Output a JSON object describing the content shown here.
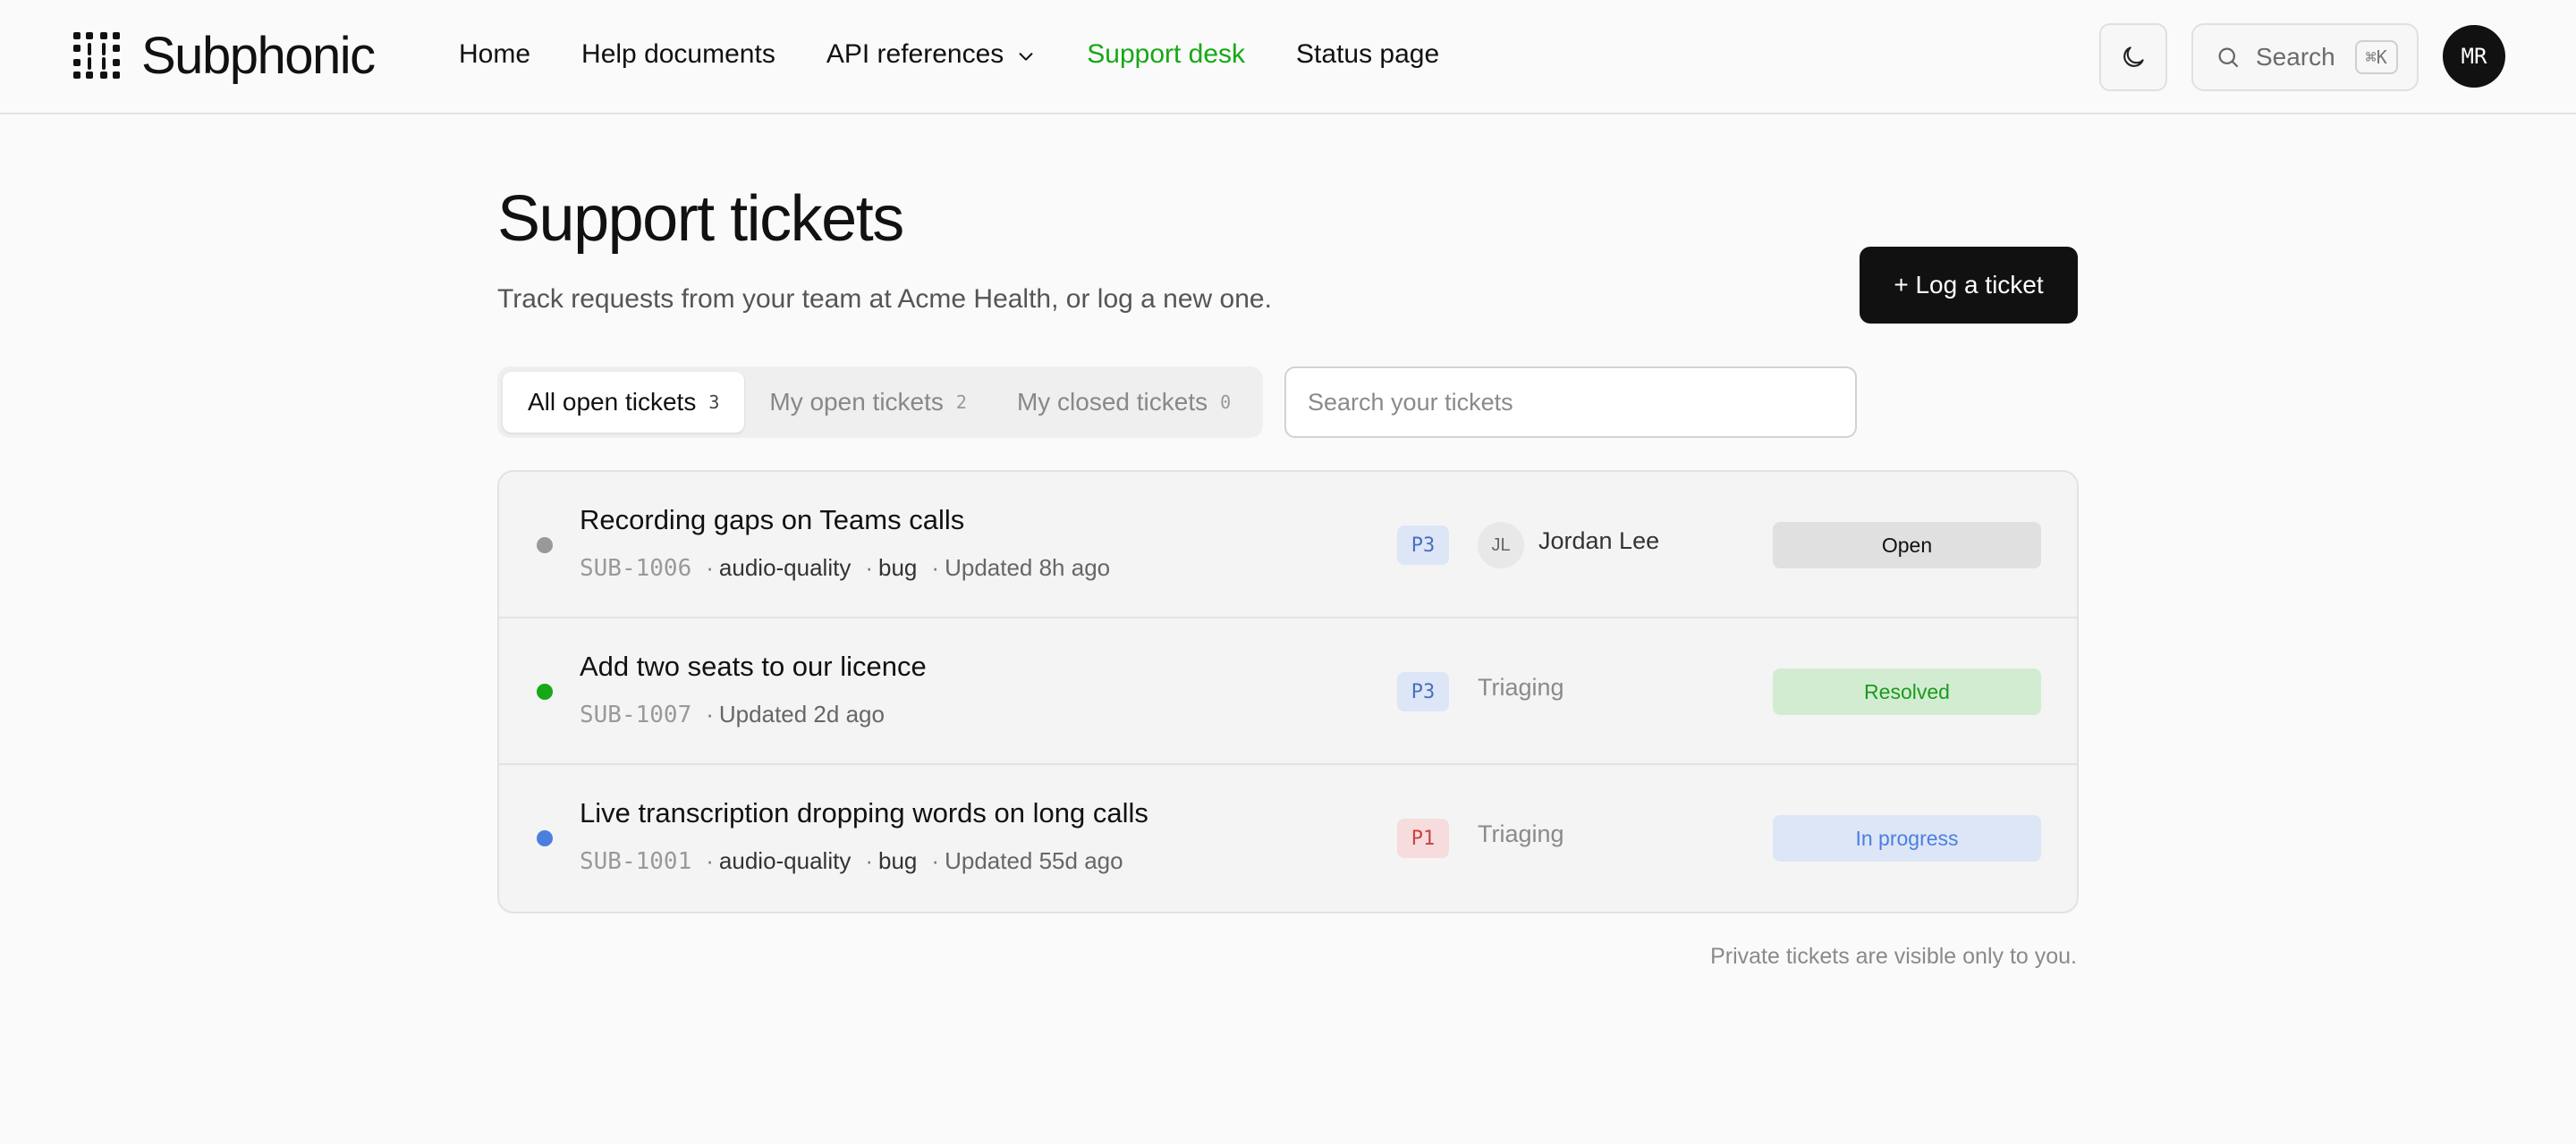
{
  "header": {
    "brand": "Subphonic",
    "nav": [
      {
        "label": "Home"
      },
      {
        "label": "Help documents"
      },
      {
        "label": "API references"
      },
      {
        "label": "Support desk"
      },
      {
        "label": "Status page"
      }
    ],
    "search_label": "Search",
    "search_shortcut": "⌘K",
    "user_initials": "MR"
  },
  "page": {
    "title": "Support tickets",
    "subtitle": "Track requests from your team at Acme Health, or log a new one.",
    "log_ticket_label": "+ Log a ticket",
    "tabs": [
      {
        "label": "All open tickets",
        "count": "3",
        "active": true
      },
      {
        "label": "My open tickets",
        "count": "2",
        "active": false
      },
      {
        "label": "My closed tickets",
        "count": "0",
        "active": false
      }
    ],
    "search_placeholder": "Search your tickets",
    "tickets": [
      {
        "title": "Recording gaps on Teams calls",
        "id": "SUB-1006",
        "tags": [
          "audio-quality",
          "bug"
        ],
        "updated": "Updated 8h ago",
        "priority": "P3",
        "assignee_initials": "JL",
        "assignee_name": "Jordan Lee",
        "status": "Open",
        "dot_color": "#999999"
      },
      {
        "title": "Add two seats to our licence",
        "id": "SUB-1007",
        "tags": [],
        "updated": "Updated 2d ago",
        "priority": "P3",
        "assignee_name": "Triaging",
        "status": "Resolved",
        "dot_color": "#16a816"
      },
      {
        "title": "Live transcription dropping words on long calls",
        "id": "SUB-1001",
        "tags": [
          "audio-quality",
          "bug"
        ],
        "updated": "Updated 55d ago",
        "priority": "P1",
        "assignee_name": "Triaging",
        "status": "In progress",
        "dot_color": "#4a7fe0"
      }
    ],
    "footnote": "Private tickets are visible only to you."
  },
  "colors": {
    "accent_green": "#16a816",
    "primary_button": "#111111",
    "p3_bg": "#dde6f6",
    "p3_text": "#4a6fbf",
    "p1_bg": "#f6dcdc",
    "p1_text": "#c94242",
    "status_open_bg": "#e0e0e0",
    "status_resolved_bg": "#d2ecd2",
    "status_resolved_text": "#1c9a1c",
    "status_inprogress_bg": "#dde6f6",
    "status_inprogress_text": "#4a7fe0"
  }
}
